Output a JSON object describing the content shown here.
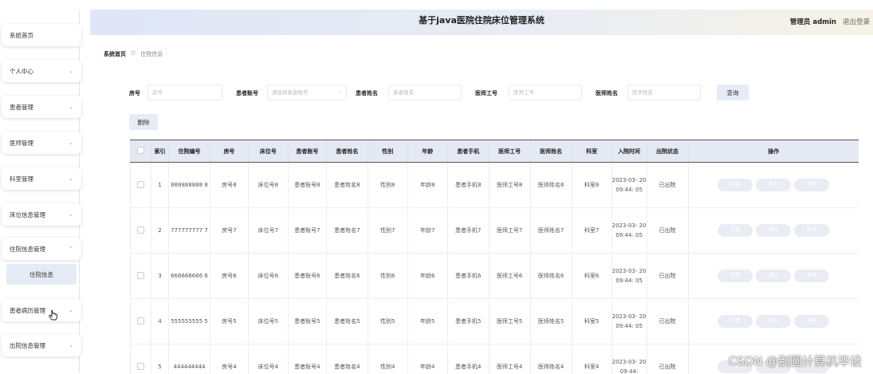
{
  "header": {
    "title": "基于java医院住院床位管理系统",
    "admin_label": "管理员 admin",
    "logout_label": "退出登录"
  },
  "sidebar": {
    "items": [
      {
        "label": "系统首页",
        "has_chevron": false
      },
      {
        "label": "个人中心",
        "has_chevron": true
      },
      {
        "label": "患者管理",
        "has_chevron": true
      },
      {
        "label": "医师管理",
        "has_chevron": true
      },
      {
        "label": "科室管理",
        "has_chevron": true
      },
      {
        "label": "床位信息管理",
        "has_chevron": true
      },
      {
        "label": "住院信息管理",
        "has_chevron": true,
        "expanded": true
      },
      {
        "label": "患者病历管理",
        "has_chevron": true
      },
      {
        "label": "出院信息管理",
        "has_chevron": true
      }
    ],
    "subitem": {
      "label": "住院信息"
    },
    "chevron_down": "⌄",
    "chevron_up": "⌃"
  },
  "breadcrumb": {
    "home": "系统首页",
    "separator": "☰",
    "current": "住院信息"
  },
  "search": {
    "room_label": "房号",
    "room_placeholder": "房号",
    "patient_account_label": "患者账号",
    "patient_account_placeholder": "请选择患者账号",
    "patient_name_label": "患者姓名",
    "patient_name_placeholder": "患者姓名",
    "doctor_id_label": "医师工号",
    "doctor_id_placeholder": "医师工号",
    "doctor_name_label": "医师姓名",
    "doctor_name_placeholder": "医师姓名",
    "query_button": "查询"
  },
  "actions": {
    "delete_button": "删除"
  },
  "table": {
    "headers": [
      "",
      "索引",
      "住院编号",
      "房号",
      "床位号",
      "患者账号",
      "患者姓名",
      "性别",
      "年龄",
      "患者手机",
      "医师工号",
      "医师姓名",
      "科室",
      "入院时间",
      "出院状态",
      "操作"
    ],
    "op_labels": [
      "详情",
      "修改",
      "删除"
    ],
    "rows": [
      {
        "index": "1",
        "id": "888888888 8",
        "room": "房号8",
        "bed": "床位号8",
        "account": "患者账号8",
        "name": "患者姓名8",
        "gender": "性别8",
        "age": "年龄8",
        "phone": "患者手机8",
        "doc_id": "医师工号8",
        "doc_name": "医师姓名8",
        "dept": "科室8",
        "time": "2023-03- 20 09:44: 05",
        "status": "已出院"
      },
      {
        "index": "2",
        "id": "777777777 7",
        "room": "房号7",
        "bed": "床位号7",
        "account": "患者账号7",
        "name": "患者姓名7",
        "gender": "性别7",
        "age": "年龄7",
        "phone": "患者手机7",
        "doc_id": "医师工号7",
        "doc_name": "医师姓名7",
        "dept": "科室7",
        "time": "2023-03- 20 09:44: 05",
        "status": "已出院"
      },
      {
        "index": "3",
        "id": "666666666 6",
        "room": "房号6",
        "bed": "床位号6",
        "account": "患者账号6",
        "name": "患者姓名6",
        "gender": "性别6",
        "age": "年龄6",
        "phone": "患者手机6",
        "doc_id": "医师工号6",
        "doc_name": "医师姓名6",
        "dept": "科室6",
        "time": "2023-03- 20 09:44: 05",
        "status": "已出院"
      },
      {
        "index": "4",
        "id": "555555555 5",
        "room": "房号5",
        "bed": "床位号5",
        "account": "患者账号5",
        "name": "患者姓名5",
        "gender": "性别5",
        "age": "年龄5",
        "phone": "患者手机5",
        "doc_id": "医师工号5",
        "doc_name": "医师姓名5",
        "dept": "科室5",
        "time": "2023-03- 20 09:44: 05",
        "status": "已出院"
      },
      {
        "index": "5",
        "id": "444444444",
        "room": "房号4",
        "bed": "床位号4",
        "account": "患者账号4",
        "name": "患者姓名4",
        "gender": "性别4",
        "age": "年龄4",
        "phone": "患者手机4",
        "doc_id": "医师工号4",
        "doc_name": "医师姓名4",
        "dept": "科室4",
        "time": "2023-03- 20 09:44:",
        "status": "已出院"
      }
    ]
  },
  "watermark": "CSDN @别圆计算机毕设",
  "icons": {
    "cursor": "hand-pointer-icon",
    "select_arrow": "chevron-down-icon"
  }
}
